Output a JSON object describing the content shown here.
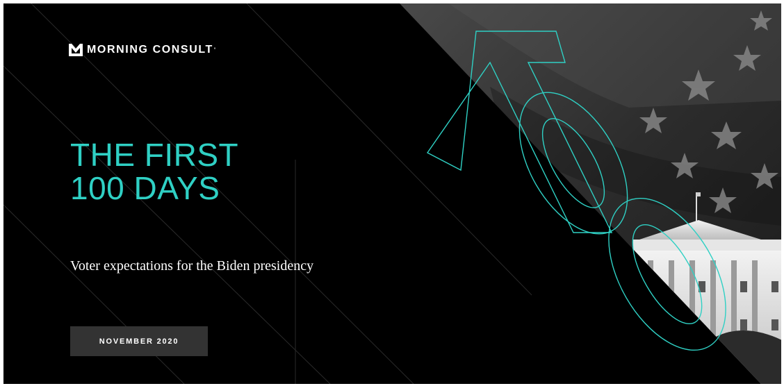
{
  "brand": {
    "name": "MORNING CONSULT",
    "trademark": "°"
  },
  "title": {
    "line1": "THE FIRST",
    "line2": "100 DAYS"
  },
  "subtitle": "Voter expectations for the Biden presidency",
  "date_badge": "NOVEMBER 2020",
  "colors": {
    "background": "#000000",
    "accent": "#2fd0c4",
    "badge": "#333333",
    "text": "#ffffff"
  },
  "decorations": {
    "big_number_outline": "100",
    "photo_subjects": [
      "us-flag-stars",
      "white-house"
    ]
  }
}
